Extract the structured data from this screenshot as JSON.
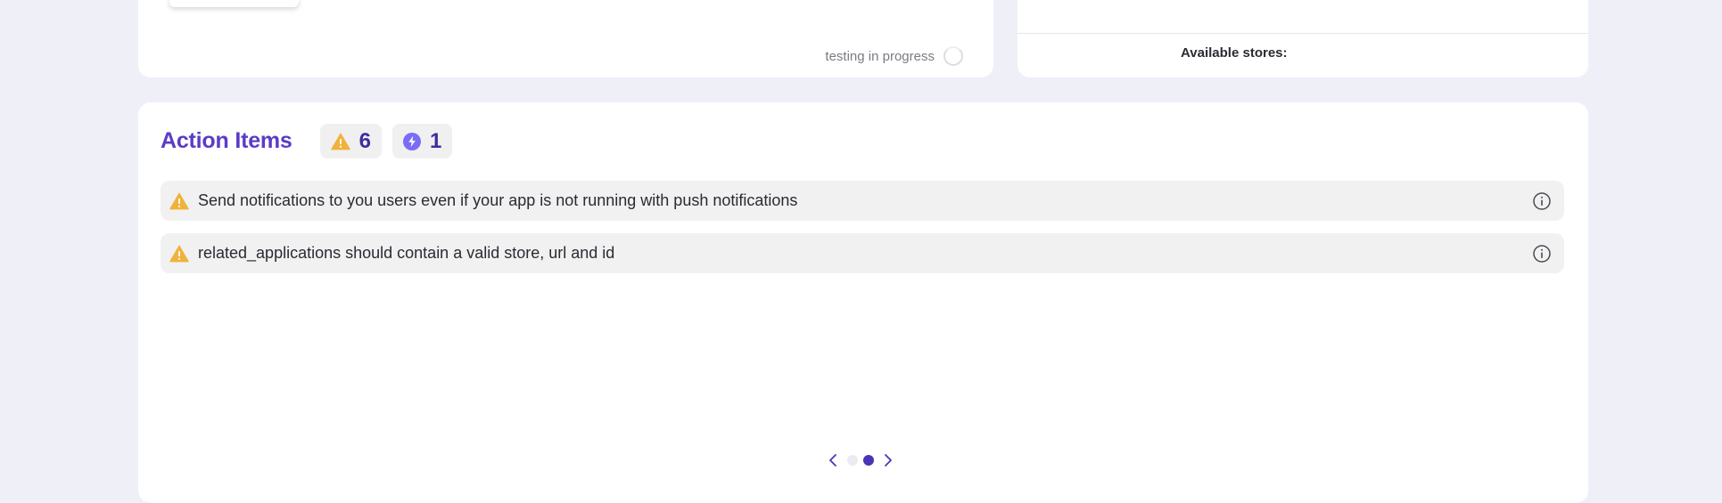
{
  "testing_card": {
    "status_text": "testing in progress"
  },
  "stores_card": {
    "label": "Available stores:"
  },
  "action_items": {
    "title": "Action Items",
    "warning_count": "6",
    "feature_count": "1",
    "items": [
      {
        "text": "Send notifications to you users even if your app is not running with push notifications",
        "icon": "warning-icon"
      },
      {
        "text": "related_applications should contain a valid store, url and id",
        "icon": "warning-icon"
      }
    ]
  },
  "pager": {
    "total_pages": 2,
    "current_page": 2
  },
  "colors": {
    "accent": "#5b3cc4",
    "warning": "#f0b23a",
    "feature": "#7b6cf6",
    "background": "#efeff8"
  }
}
